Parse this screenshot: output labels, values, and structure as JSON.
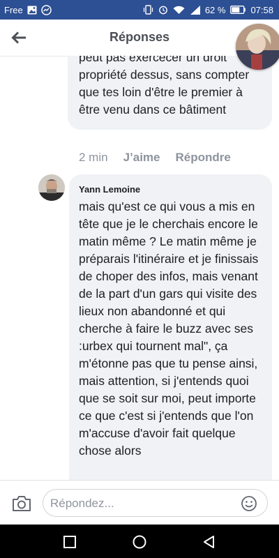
{
  "status_bar": {
    "carrier": "Free",
    "battery": "62 %",
    "time": "07:58",
    "background_color": "#2d4f93",
    "icons": [
      "image-icon",
      "messenger-icon",
      "vibrate-icon",
      "alarm-icon",
      "wifi-icon",
      "signal-icon",
      "battery-icon"
    ]
  },
  "header": {
    "title": "Réponses",
    "back_icon": "arrow-left-icon"
  },
  "comments": [
    {
      "text": "peut pas exercecer un droit propriété dessus, sans compter que tes loin d'être le premier à être venu dans ce bâtiment",
      "time": "2 min",
      "like_label": "J’aime",
      "reply_label": "Répondre"
    },
    {
      "author": "Yann Lemoine",
      "text": "mais qu'est ce qui vous a mis en tête que je le cherchais encore le matin même ? Le matin même je préparais l'itinéraire et je finissais de choper des infos, mais venant de la part d'un gars qui visite des lieux non abandonné et qui cherche à faire le buzz avec ses :urbex qui tournent mal\", ça m'étonne pas que tu pense ainsi, mais attention, si j'entends quoi que se soit sur moi, peut importe ce que c'est si j'entends que l'on m'accuse d'avoir fait quelque chose alors"
    }
  ],
  "composer": {
    "placeholder": "Répondez...",
    "camera_icon": "camera-icon",
    "emoji_icon": "emoji-icon"
  },
  "nav": {
    "icons": [
      "recent-apps-icon",
      "home-icon",
      "back-icon"
    ]
  }
}
